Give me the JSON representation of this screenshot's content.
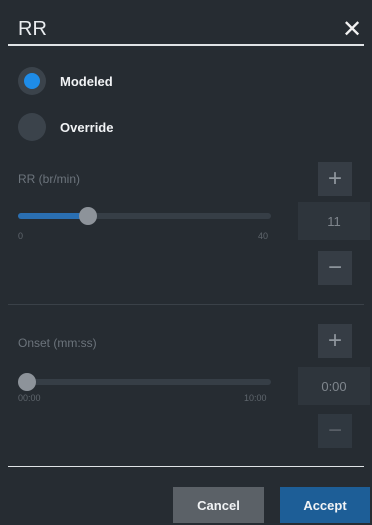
{
  "dialog": {
    "title": "RR",
    "close_icon": "close-icon"
  },
  "mode": {
    "options": [
      {
        "label": "Modeled",
        "selected": true
      },
      {
        "label": "Override",
        "selected": false
      }
    ],
    "accent_color": "#1e8ce8"
  },
  "rr": {
    "label": "RR (br/min)",
    "min_label": "0",
    "max_label": "40",
    "value": "11",
    "fraction": 0.275
  },
  "onset": {
    "label": "Onset (mm:ss)",
    "min_label": "00:00",
    "max_label": "10:00",
    "value": "0:00",
    "fraction": 0
  },
  "footer": {
    "cancel_label": "Cancel",
    "accept_label": "Accept",
    "accept_color": "#1d5e97"
  }
}
